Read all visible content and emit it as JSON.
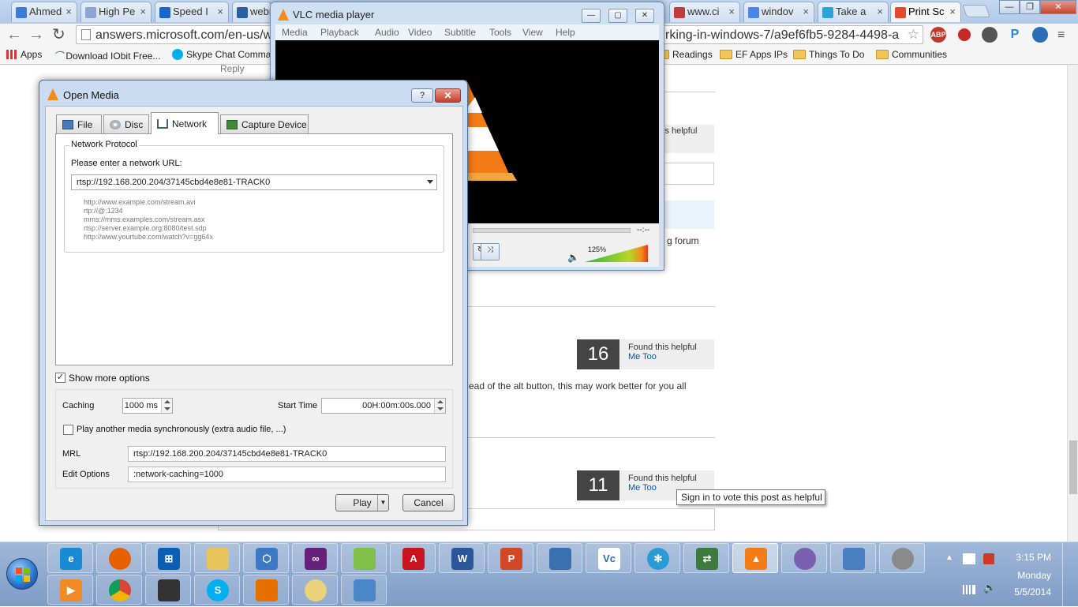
{
  "chrome": {
    "tabs": [
      {
        "label": "Ahmed",
        "color": "#3b7bd4"
      },
      {
        "label": "High Pe",
        "color": "#8aa7d4"
      },
      {
        "label": "Speed I",
        "color": "#1a66c8"
      },
      {
        "label": "webr",
        "color": "#2c5f9e"
      },
      {
        "label": "www.ci",
        "color": "#c23a3a"
      },
      {
        "label": "windov",
        "color": "#4a86e8"
      },
      {
        "label": "Take a",
        "color": "#2aa3d9"
      },
      {
        "label": "Print Sc",
        "color": "#e24b2b"
      }
    ],
    "url": "answers.microsoft.com/en-us/w",
    "url_tail": "rking-in-windows-7/a9ef6fb5-9284-4498-a",
    "extensions": [
      "ABP",
      "P"
    ],
    "bookmarks": {
      "apps": "Apps",
      "iobit": "Download IObit Free...",
      "skype": "Skype Chat Comma",
      "readings": "Readings",
      "ef": "EF Apps IPs",
      "things": "Things To Do",
      "communities": "Communities"
    }
  },
  "page": {
    "reply": "Reply",
    "helpful_partial": "is helpful",
    "forum_partial": "g forum",
    "alt_text": "ead of the alt button, this may work better for you all",
    "votes": [
      {
        "count": "16",
        "label": "Found this helpful",
        "link": "Me Too"
      },
      {
        "count": "11",
        "label": "Found this helpful",
        "link": "Me Too"
      }
    ],
    "tooltip": "Sign in to vote this post as helpful"
  },
  "vlc": {
    "title": "VLC media player",
    "menu": [
      "Media",
      "Playback",
      "Audio",
      "Video",
      "Subtitle",
      "Tools",
      "View",
      "Help"
    ],
    "time": "--:--",
    "volume": "125%",
    "volume_fraction": 1.25
  },
  "dialog": {
    "title": "Open Media",
    "help": "?",
    "tabs": [
      "File",
      "Disc",
      "Network",
      "Capture Device"
    ],
    "group_label": "Network Protocol",
    "prompt": "Please enter a network URL:",
    "url": "rtsp://192.168.200.204/37145cbd4e8e81-TRACK0",
    "examples": [
      "http://www.example.com/stream.avi",
      "rtp://@:1234",
      "mms://mms.examples.com/stream.asx",
      "rtsp://server.example.org:8080/test.sdp",
      "http://www.yourtube.com/watch?v=gg64x"
    ],
    "show_more": "Show more options",
    "caching_label": "Caching",
    "caching_value": "1000 ms",
    "start_time_label": "Start Time",
    "start_time_value": "00H:00m:00s.000",
    "sync_label": "Play another media synchronously (extra audio file, ...)",
    "mrl_label": "MRL",
    "mrl_value": "rtsp://192.168.200.204/37145cbd4e8e81-TRACK0",
    "edit_options_label": "Edit Options",
    "edit_options_value": ":network-caching=1000",
    "play": "Play",
    "cancel": "Cancel"
  },
  "taskbar": {
    "time": "3:15 PM",
    "day": "Monday",
    "date": "5/5/2014"
  }
}
